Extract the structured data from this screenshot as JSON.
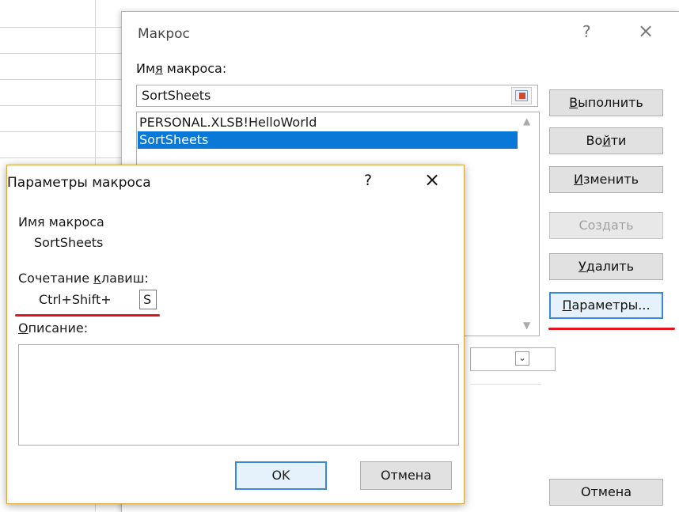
{
  "macro_dialog": {
    "title": "Макрос",
    "help": "?",
    "close": "×",
    "name_label_pre": "Им",
    "name_label_ul": "я",
    "name_label_post": " макроса:",
    "name_value": "SortSheets",
    "list_items": [
      "PERSONAL.XLSB!HelloWorld",
      "SortSheets"
    ],
    "selected_index": 1,
    "buttons": {
      "run": {
        "ul": "В",
        "rest": "ыполнить"
      },
      "step_into_pre": "Во",
      "step_into_ul": "й",
      "step_into_post": "ти",
      "edit": {
        "ul": "И",
        "rest": "зменить"
      },
      "create": "Создать",
      "delete": {
        "ul": "У",
        "rest": "далить"
      },
      "options": {
        "ul": "П",
        "rest": "араметры..."
      },
      "cancel": "Отмена"
    }
  },
  "params_dialog": {
    "title": "Параметры макроса",
    "help": "?",
    "close": "×",
    "name_label": "Имя макроса",
    "name_value": "SortSheets",
    "shortcut_label_pre": "Сочетание ",
    "shortcut_label_ul": "к",
    "shortcut_label_post": "лавиш:",
    "shortcut_prefix": "Ctrl+Shift+",
    "shortcut_key": "S",
    "description_label_ul": "О",
    "description_label_post": "писание:",
    "description_value": "",
    "ok": "OK",
    "cancel": "Отмена"
  },
  "colors": {
    "selection": "#0a78d7",
    "annotation": "#e0161c",
    "dialog_border": "#d9a742"
  }
}
